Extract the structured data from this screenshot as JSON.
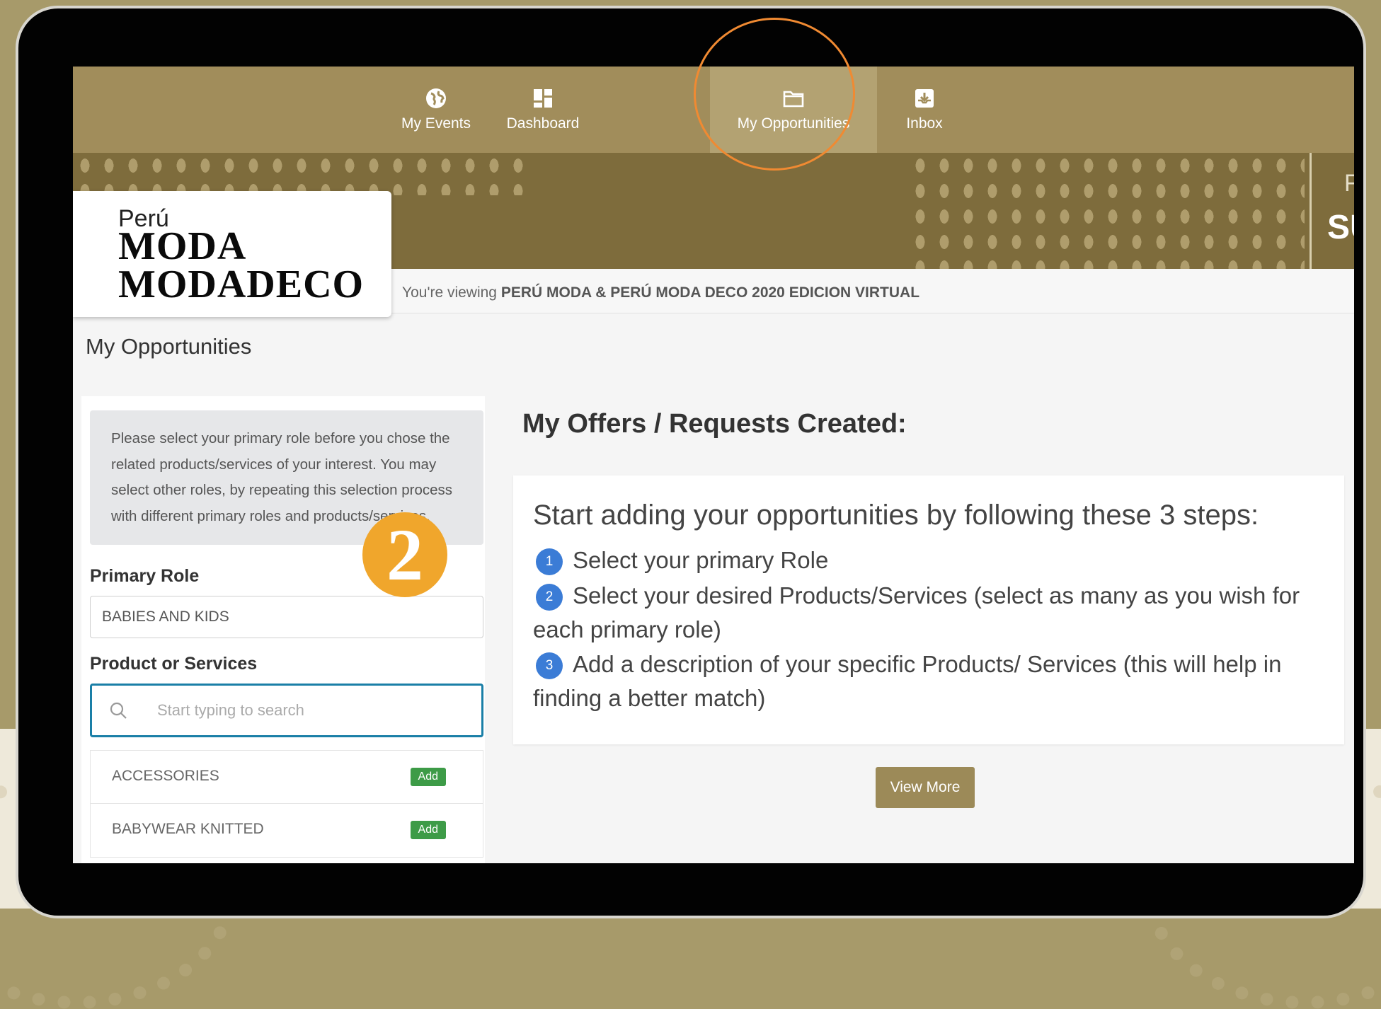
{
  "nav": {
    "items": [
      {
        "label": "My Events",
        "icon": "globe-icon"
      },
      {
        "label": "Dashboard",
        "icon": "dashboard-icon"
      },
      {
        "label": "My Opportunities",
        "icon": "folder-icon"
      },
      {
        "label": "Inbox",
        "icon": "inbox-icon"
      }
    ],
    "active": "My Opportunities"
  },
  "banner": {
    "partial_text_small": "F",
    "partial_text": "SU"
  },
  "logo": {
    "line1": "Perú",
    "line2": "MODA",
    "line3": "MODADECO"
  },
  "viewing": {
    "prefix": "You're viewing",
    "event": "PERÚ MODA & PERÚ MODA DECO 2020 EDICION VIRTUAL"
  },
  "page_title": "My Opportunities",
  "left": {
    "notice": "Please select your primary role before you chose the related products/services of your interest. You may select other roles, by repeating this selection process with different primary roles and products/services.",
    "primary_role_label": "Primary Role",
    "primary_role_value": "BABIES AND KIDS",
    "products_label": "Product or Services",
    "search_placeholder": "Start typing to search",
    "products": [
      {
        "name": "ACCESSORIES",
        "action": "Add"
      },
      {
        "name": "BABYWEAR KNITTED",
        "action": "Add"
      }
    ]
  },
  "step_badge": "2",
  "offers": {
    "title": "My Offers / Requests Created:",
    "heading": "Start adding your opportunities by following these 3 steps:",
    "steps": [
      {
        "num": "1",
        "text": "Select your primary Role"
      },
      {
        "num": "2",
        "text": "Select your desired Products/Services (select as many as you wish for each primary role)"
      },
      {
        "num": "3",
        "text": "Add a description of your specific Products/ Services (this will help in finding a better match)"
      }
    ],
    "view_more": "View More"
  },
  "colors": {
    "nav_bg": "#a18d5b",
    "accent_olive": "#9c8a58",
    "highlight_ring": "#f08a32",
    "badge_orange": "#f0a62c",
    "step_blue": "#3b7cd6",
    "add_green": "#3d9b47",
    "search_border": "#1a7fa7"
  }
}
